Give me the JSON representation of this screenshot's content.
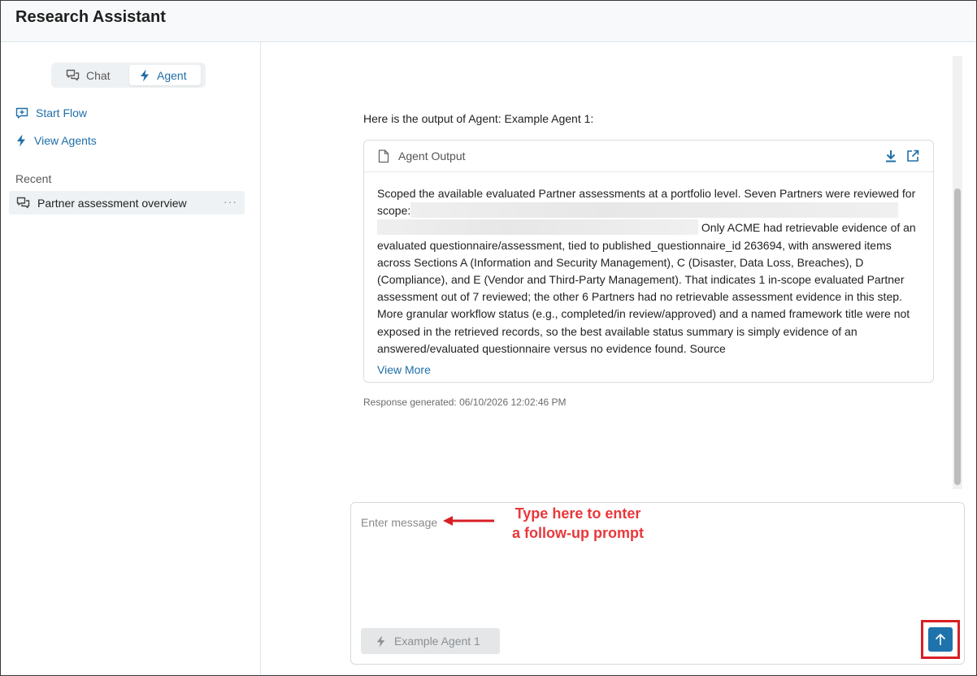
{
  "app": {
    "title": "Research Assistant"
  },
  "sidebar": {
    "modes": [
      {
        "label": "Chat",
        "icon": "chat-bubbles-icon",
        "active": false
      },
      {
        "label": "Agent",
        "icon": "lightning-icon",
        "active": true
      }
    ],
    "links": [
      {
        "label": "Start Flow",
        "icon": "add-box-icon"
      },
      {
        "label": "View Agents",
        "icon": "lightning-icon"
      }
    ],
    "recent_label": "Recent",
    "recent": [
      {
        "label": "Partner assessment overview",
        "icon": "chat-bubbles-icon",
        "more": "···"
      }
    ]
  },
  "conversation": {
    "intro": "Here is the output of Agent: Example Agent 1:",
    "output_card": {
      "title": "Agent Output",
      "icons": [
        "document-icon",
        "download-icon",
        "open-external-icon"
      ],
      "text_part1": "Scoped the available evaluated Partner assessments at a portfolio level. Seven Partners were reviewed for scope:",
      "text_part2": " Only ACME had retrievable evidence of an evaluated questionnaire/assessment, tied to published_questionnaire_id 263694, with answered items across Sections A (Information and Security Management), C (Disaster, Data Loss, Breaches), D (Compliance), and E (Vendor and Third-Party Management). That indicates 1 in-scope evaluated Partner assessment out of 7 reviewed; the other 6 Partners had no retrievable assessment evidence in this step. More granular workflow status (e.g., completed/in review/approved) and a named framework title were not exposed in the retrieved records, so the best available status summary is simply evidence of an answered/evaluated questionnaire versus no evidence found. Source",
      "view_more": "View More"
    },
    "timestamp": "Response generated: 06/10/2026 12:02:46 PM"
  },
  "composer": {
    "placeholder": "Enter message",
    "value": "",
    "agent_chip": "Example Agent 1",
    "send_icon": "arrow-up-icon"
  },
  "annotation": {
    "line1": "Type here to enter",
    "line2": "a follow-up prompt",
    "color": "#e8383b",
    "highlight_color": "#d81f26"
  },
  "colors": {
    "accent": "#1e6fa8",
    "send_button": "#1e73ac"
  }
}
